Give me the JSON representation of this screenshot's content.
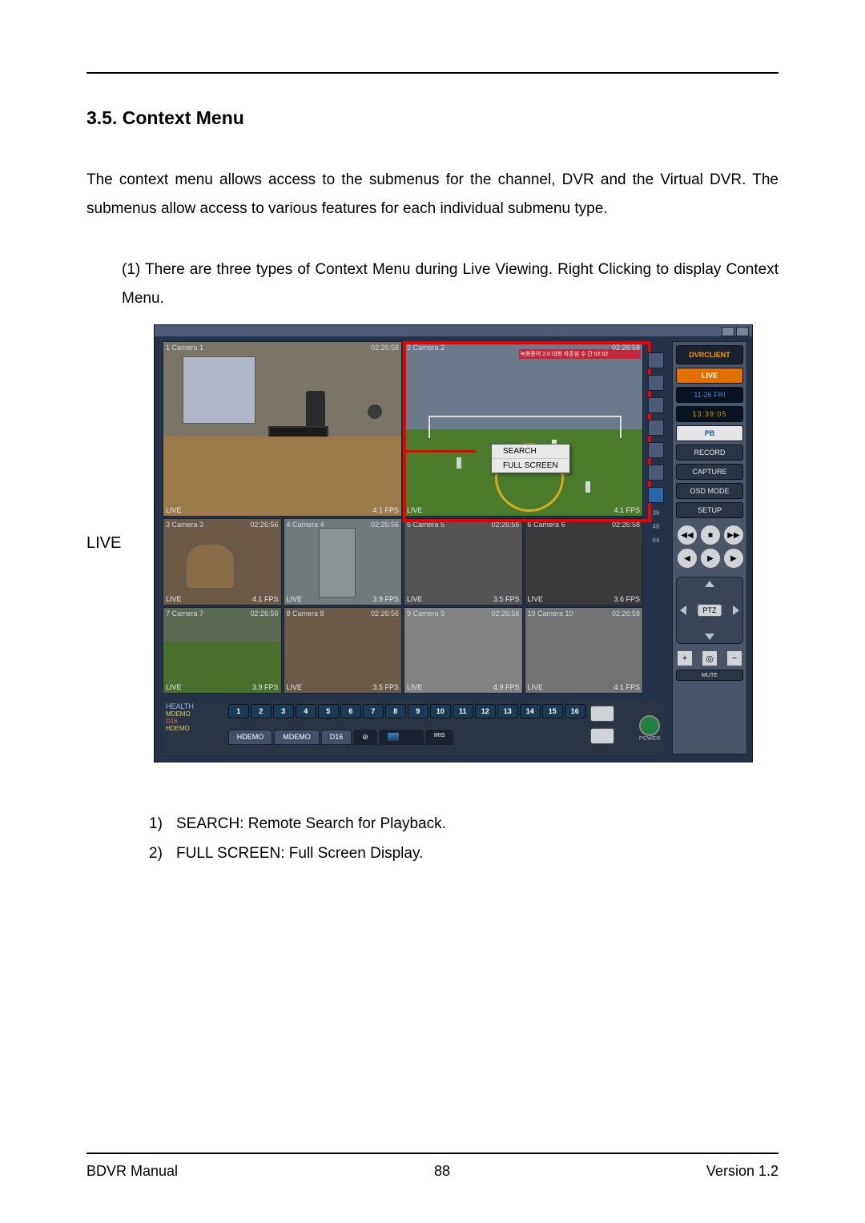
{
  "heading": "3.5. Context Menu",
  "intro": "The context menu allows access to the submenus for the channel, DVR and the Virtual DVR. The submenus allow access to various features for each individual submenu type.",
  "list1_num": "(1)",
  "list1_text": "There are three types of Context Menu during Live Viewing. Right Clicking to display Context Menu.",
  "live_label": "LIVE",
  "dvr": {
    "ad_banner": "녹화중이 2.0 대회 자존심 수 간 02:02",
    "cells": {
      "c1_name": "1 Camera 1",
      "c1_ts": "02:26:58",
      "c2_name": "2 Camera 2",
      "c2_ts": "02:26:58",
      "c3_name": "3 Camera 3",
      "c3_ts": "02:26:56",
      "c4_name": "4 Camera 4",
      "c4_ts": "02:26:56",
      "c5_name": "5 Camera 5",
      "c5_ts": "02:26:56",
      "c6_name": "6 Camera 6",
      "c6_ts": "02:26:58",
      "c7_name": "7 Camera 7",
      "c7_ts": "02:26:56",
      "c8_name": "8 Camera 8",
      "c8_ts": "02:26:56",
      "c9_name": "9 Camera 9",
      "c9_ts": "02:26:56",
      "c10_name": "10 Camera 10",
      "c10_ts": "02:26:58",
      "status_live": "LIVE",
      "fps41": "4.1 FPS",
      "fps39": "3.9 FPS",
      "fps35": "3.5 FPS",
      "fps36": "3.6 FPS",
      "fps49": "4.9 FPS"
    },
    "ctx": {
      "search": "SEARCH",
      "fullscreen": "FULL SCREEN"
    },
    "layout_labels": [
      "36",
      "48",
      "64"
    ],
    "side": {
      "logo": "DVRCLIENT",
      "live": "LIVE",
      "date": "11-26  FRI",
      "time": "13:39:05",
      "pb": "PB",
      "record": "RECORD",
      "capture": "CAPTURE",
      "osd": "OSD MODE",
      "setup": "SETUP",
      "ptz": "PTZ",
      "mute": "MUTE",
      "power": "POWER"
    },
    "bottom": {
      "health_hd": "HEALTH",
      "h1": "MDEMO",
      "h2": "D16",
      "h3": "HDEMO",
      "channels": [
        "1",
        "2",
        "3",
        "4",
        "5",
        "6",
        "7",
        "8",
        "9",
        "10",
        "11",
        "12",
        "13",
        "14",
        "15",
        "16"
      ],
      "tabs": [
        "HDEMO",
        "MDEMO",
        "D16"
      ],
      "iris": "IRIS"
    }
  },
  "sub": {
    "i1": "1)",
    "t1": "SEARCH: Remote Search for Playback.",
    "i2": "2)",
    "t2": "FULL SCREEN: Full Screen Display."
  },
  "footer": {
    "left": "BDVR Manual",
    "center": "88",
    "right": "Version 1.2"
  }
}
